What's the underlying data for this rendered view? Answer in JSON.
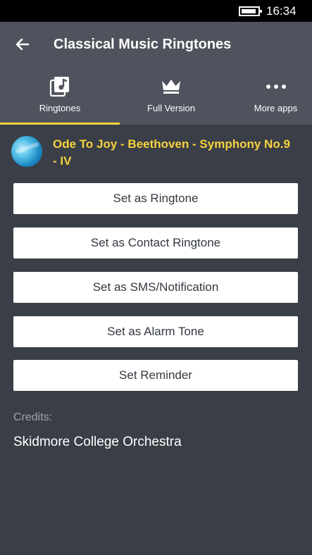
{
  "status_bar": {
    "time": "16:34",
    "battery_icon": "battery-icon"
  },
  "header": {
    "back_icon": "back-arrow-icon",
    "title": "Classical Music Ringtones"
  },
  "tabs": [
    {
      "label": "Ringtones",
      "icon": "music-library-icon",
      "selected": true
    },
    {
      "label": "Full Version",
      "icon": "crown-icon",
      "selected": false
    },
    {
      "label": "More apps",
      "icon": "more-dots-icon",
      "selected": false
    }
  ],
  "song": {
    "title": "Ode To Joy - Beethoven - Symphony No.9 - IV",
    "art_icon": "album-art"
  },
  "actions": [
    {
      "label": "Set as Ringtone"
    },
    {
      "label": "Set as Contact Ringtone"
    },
    {
      "label": "Set as SMS/Notification"
    },
    {
      "label": "Set as Alarm Tone"
    },
    {
      "label": "Set Reminder"
    }
  ],
  "credits": {
    "label": "Credits:",
    "value": "Skidmore College Orchestra"
  },
  "colors": {
    "accent": "#f7d33e",
    "background": "#3a3e46",
    "header": "#4f535d",
    "button": "#ffffff",
    "button_text": "#333840"
  }
}
